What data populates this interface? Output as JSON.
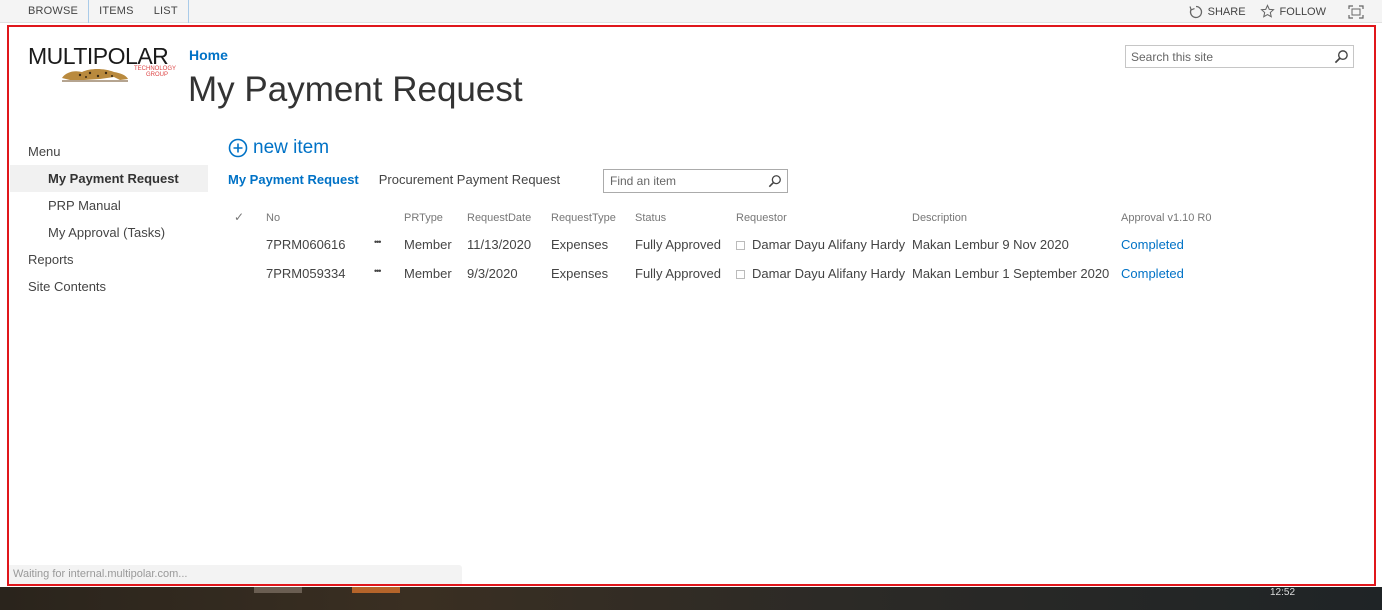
{
  "ribbon": {
    "tabs": [
      "BROWSE",
      "ITEMS",
      "LIST"
    ],
    "share_label": "SHARE",
    "follow_label": "FOLLOW"
  },
  "logo": {
    "name": "MULTIPOLAR",
    "sub": "TECHNOLOGY GROUP"
  },
  "breadcrumb": {
    "home": "Home"
  },
  "page": {
    "title": "My Payment Request"
  },
  "site_search": {
    "placeholder": "Search this site"
  },
  "nav": {
    "items": [
      {
        "label": "Menu"
      },
      {
        "label": "My Payment Request"
      },
      {
        "label": "PRP Manual"
      },
      {
        "label": "My Approval (Tasks)"
      },
      {
        "label": "Reports"
      },
      {
        "label": "Site Contents"
      }
    ]
  },
  "list": {
    "new_item": "new item",
    "views": [
      "My Payment Request",
      "Procurement Payment Request"
    ],
    "find_placeholder": "Find an item",
    "columns": {
      "check": "✓",
      "no": "No",
      "prtype": "PRType",
      "requestdate": "RequestDate",
      "requesttype": "RequestType",
      "status": "Status",
      "requestor": "Requestor",
      "description": "Description",
      "approval": "Approval v1.10 R0"
    },
    "ellipsis": "•••",
    "rows": [
      {
        "no": "7PRM060616",
        "prtype": "Member",
        "requestdate": "11/13/2020",
        "requesttype": "Expenses",
        "status": "Fully Approved",
        "requestor": "Damar Dayu Alifany Hardy",
        "description": "Makan Lembur 9 Nov 2020",
        "approval": "Completed"
      },
      {
        "no": "7PRM059334",
        "prtype": "Member",
        "requestdate": "9/3/2020",
        "requesttype": "Expenses",
        "status": "Fully Approved",
        "requestor": "Damar Dayu Alifany Hardy",
        "description": "Makan Lembur 1 September 2020",
        "approval": "Completed"
      }
    ]
  },
  "status_bar": {
    "text": "Waiting for internal.multipolar.com..."
  },
  "taskbar": {
    "clock": "12:52"
  },
  "colors": {
    "accent": "#0072c6",
    "frame": "#e0161b",
    "nav_selected_bg": "#f1f1f1"
  }
}
